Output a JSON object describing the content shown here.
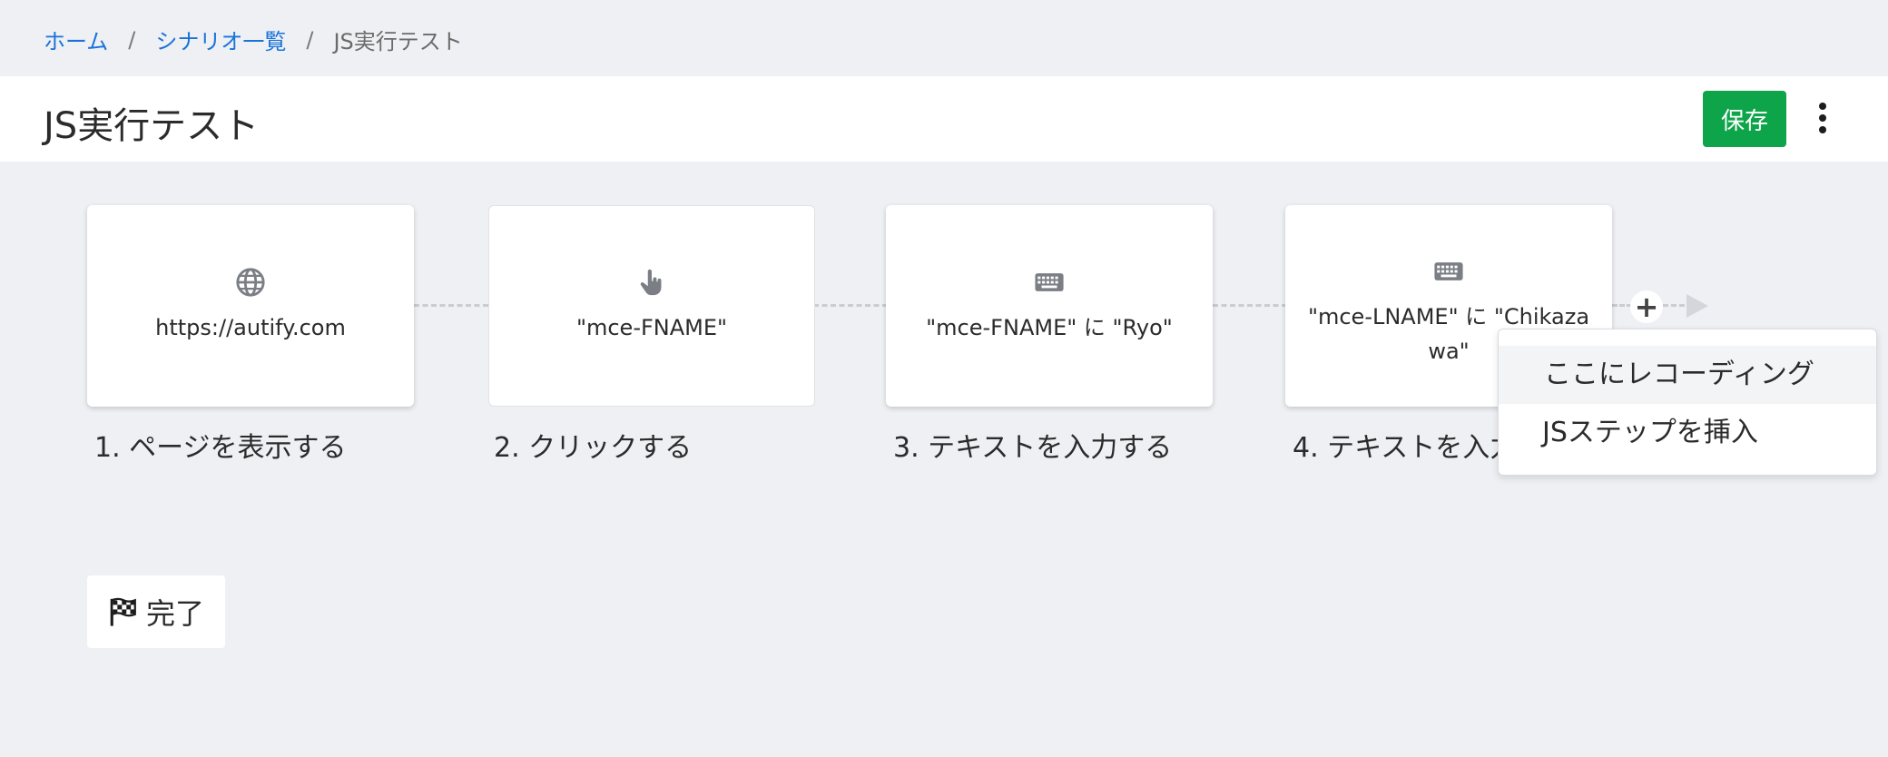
{
  "breadcrumb": {
    "home": "ホーム",
    "separator": "/",
    "scenarios": "シナリオ一覧",
    "current": "JS実行テスト"
  },
  "header": {
    "title": "JS実行テスト",
    "save_label": "保存",
    "more_icon": "vertical-dots-icon"
  },
  "steps": [
    {
      "icon": "globe-icon",
      "text": "https://autify.com",
      "label": "1. ページを表示する"
    },
    {
      "icon": "pointer-hand-icon",
      "text": "\"mce-FNAME\"",
      "label": "2. クリックする"
    },
    {
      "icon": "keyboard-icon",
      "text": "\"mce-FNAME\" に \"Ryo\"",
      "label": "3. テキストを入力する"
    },
    {
      "icon": "keyboard-icon",
      "text": "\"mce-LNAME\" に \"Chikazawa\"",
      "label": "4. テキストを入力する"
    }
  ],
  "add_step": {
    "icon": "plus-icon",
    "symbol": "+"
  },
  "popup": {
    "items": [
      "ここにレコーディング",
      "JSステップを挿入"
    ]
  },
  "finish": {
    "icon": "checkered-flag-icon",
    "label": "完了"
  },
  "colors": {
    "accent_link": "#1a73d9",
    "save_button": "#0ea54a",
    "background": "#eef0f4"
  }
}
